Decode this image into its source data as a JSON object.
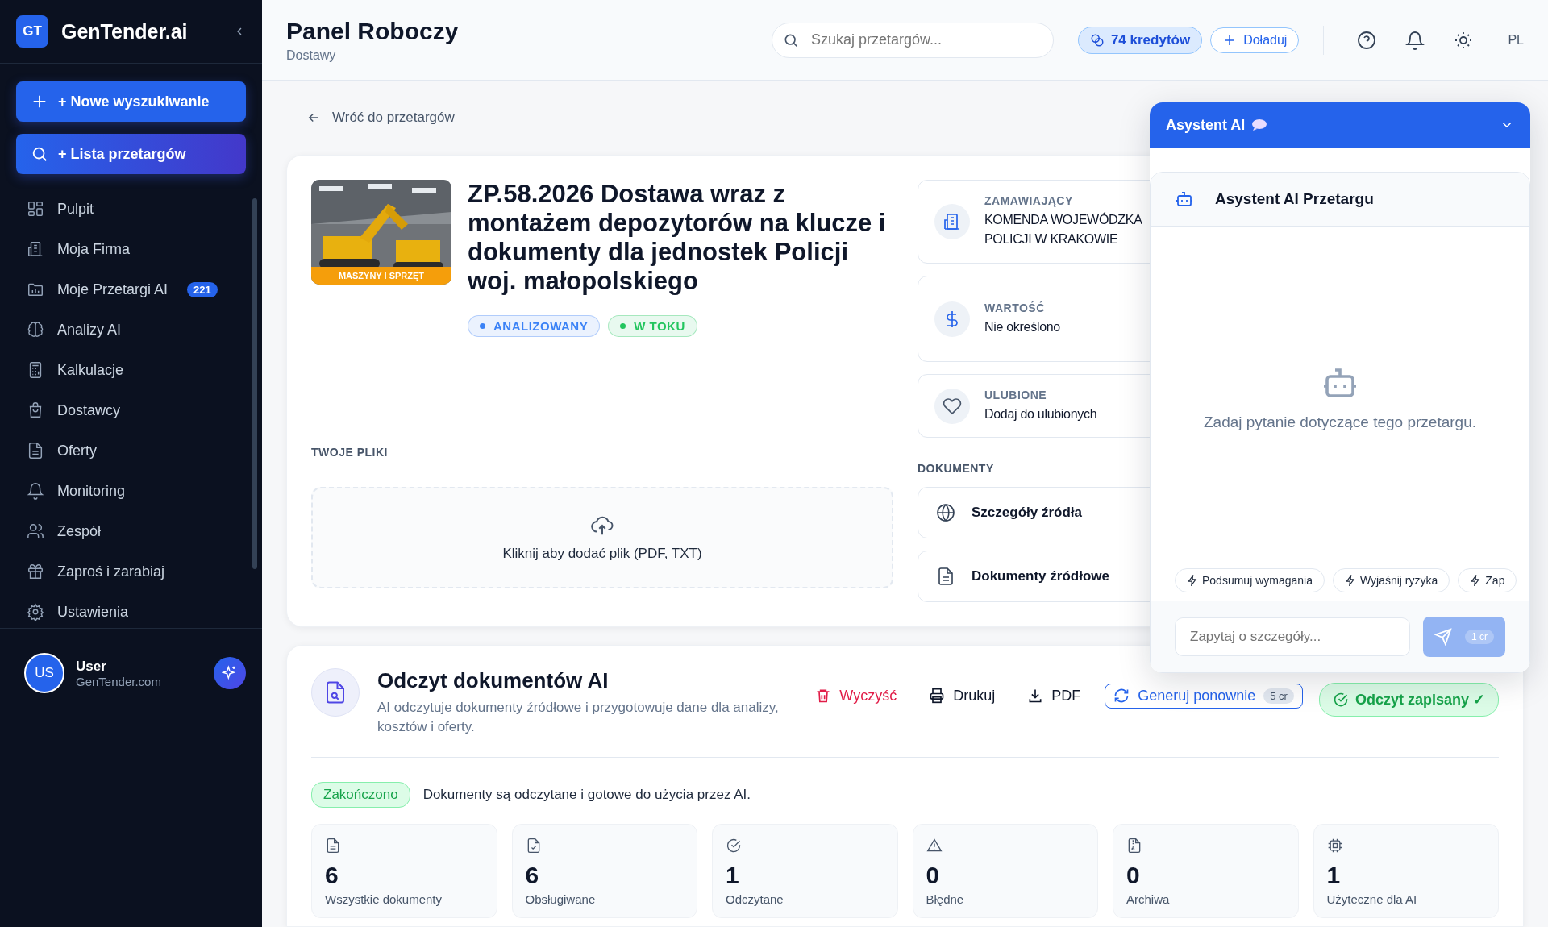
{
  "sidebar": {
    "logo_badge": "GT",
    "brand": "GenTender.ai",
    "actions": [
      {
        "kind": "plus",
        "label": "+ Nowe wyszukiwanie"
      },
      {
        "kind": "search",
        "label": "+ Lista przetargów"
      }
    ],
    "items": [
      {
        "label": "Pulpit"
      },
      {
        "label": "Moja Firma"
      },
      {
        "label": "Moje Przetargi AI",
        "badge": "221"
      },
      {
        "label": "Analizy AI"
      },
      {
        "label": "Kalkulacje"
      },
      {
        "label": "Dostawcy"
      },
      {
        "label": "Oferty"
      },
      {
        "label": "Monitoring"
      },
      {
        "label": "Zespół"
      },
      {
        "label": "Zaproś i zarabiaj"
      },
      {
        "label": "Ustawienia"
      }
    ],
    "user": {
      "avatar": "US",
      "name": "User",
      "email": "GenTender.com"
    }
  },
  "header": {
    "title": "Panel Roboczy",
    "subtitle": "Dostawy",
    "search": {
      "placeholder": "Szukaj przetargów..."
    },
    "credits": "74 kredytów",
    "topup": "Doładuj",
    "language": "PL"
  },
  "back_link": "Wróć do przetargów",
  "tender": {
    "image_label": "MASZYNY I SPRZĘT",
    "title": "ZP.58.2026 Dostawa wraz z montażem depozytorów na klucze i dokumenty dla jednostek Policji woj. małopolskiego",
    "tags": [
      {
        "label": "ANALIZOWANY",
        "color": "#3b82f6"
      },
      {
        "label": "W TOKU",
        "color": "#22c55e"
      }
    ],
    "info": [
      {
        "kind": "buyer",
        "label": "ZAMAWIAJĄCY",
        "value": "KOMENDA WOJEWÓDZKA POLICJI W KRAKOWIE"
      },
      {
        "kind": "value",
        "label": "WARTOŚĆ",
        "value": "Nie określono"
      },
      {
        "kind": "favorite",
        "label": "ULUBIONE",
        "value": "Dodaj do ulubionych"
      }
    ],
    "files_heading": "TWOJE PLIKI",
    "upload_hint": "Kliknij aby dodać plik (PDF, TXT)",
    "docs_heading": "DOKUMENTY",
    "docs": [
      {
        "kind": "globe",
        "label": "Szczegóły źródła"
      },
      {
        "kind": "file",
        "label": "Dokumenty źródłowe"
      }
    ]
  },
  "reader": {
    "title": "Odczyt dokumentów AI",
    "description": "AI odczytuje dokumenty źródłowe i przygotowuje dane dla analizy, kosztów i oferty.",
    "actions": [
      {
        "kind": "clear",
        "label": "Wyczyść"
      },
      {
        "kind": "print",
        "label": "Drukuj"
      },
      {
        "kind": "download",
        "label": "PDF"
      },
      {
        "kind": "regenerate",
        "label": "Generuj ponownie",
        "cost": "5 cr"
      }
    ],
    "saved": "Odczyt zapisany ✓",
    "status": "Zakończono",
    "status_text": "Dokumenty są odczytane i gotowe do użycia przez AI.",
    "stats": [
      {
        "value": "6",
        "label": "Wszystkie dokumenty"
      },
      {
        "value": "6",
        "label": "Obsługiwane"
      },
      {
        "value": "1",
        "label": "Odczytane"
      },
      {
        "value": "0",
        "label": "Błędne"
      },
      {
        "value": "0",
        "label": "Archiwa"
      },
      {
        "value": "1",
        "label": "Użyteczne dla AI"
      }
    ]
  },
  "assistant": {
    "title": "Asystent AI",
    "heading": "Asystent AI Przetargu",
    "empty_text": "Zadaj pytanie dotyczące tego przetargu.",
    "suggestions": [
      "Podsumuj wymagania",
      "Wyjaśnij ryzyka",
      "Zap"
    ],
    "input": {
      "placeholder": "Zapytaj o szczegóły..."
    },
    "send": {
      "cost": "1 cr",
      "disabled": true
    }
  }
}
